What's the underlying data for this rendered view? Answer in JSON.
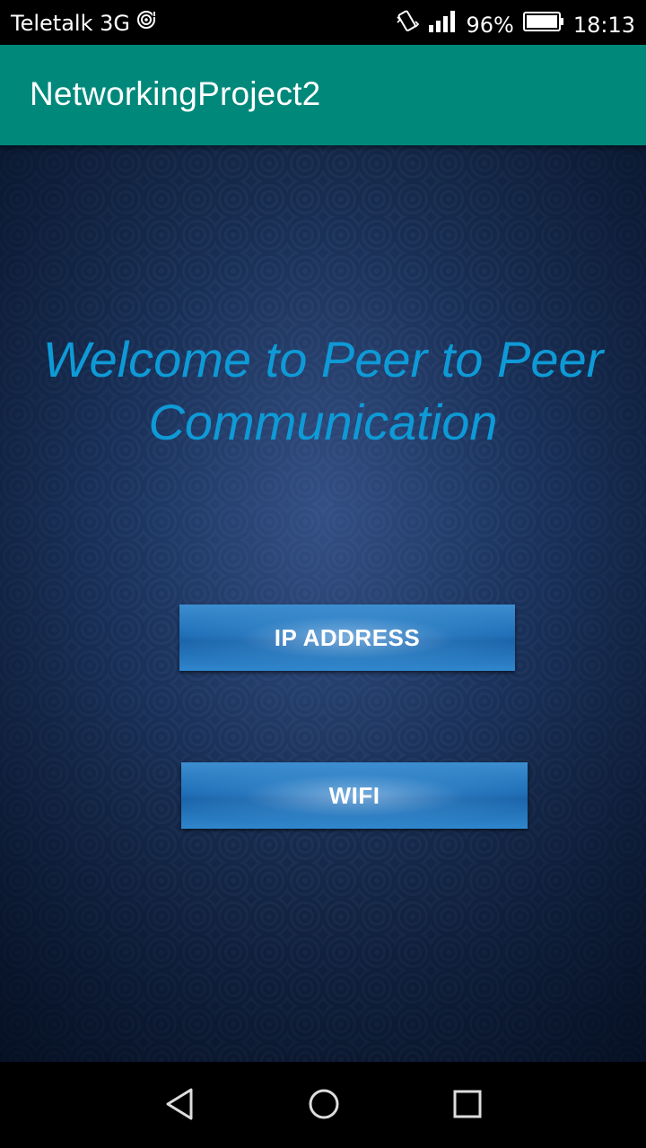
{
  "status_bar": {
    "carrier": "Teletalk 3G",
    "battery_percent": "96%",
    "time": "18:13",
    "icons": [
      "hotspot-icon",
      "vibrate-icon",
      "signal-icon",
      "battery-icon"
    ]
  },
  "app_bar": {
    "title": "NetworkingProject2",
    "color": "#00897b"
  },
  "main": {
    "welcome_line1": "Welcome to Peer to Peer",
    "welcome_line2": "Communication",
    "welcome_color": "#0e9ad6",
    "buttons": [
      {
        "label": "IP ADDRESS"
      },
      {
        "label": "WIFI"
      }
    ]
  },
  "nav_bar": {
    "icons": [
      "back-icon",
      "home-icon",
      "recents-icon"
    ]
  }
}
